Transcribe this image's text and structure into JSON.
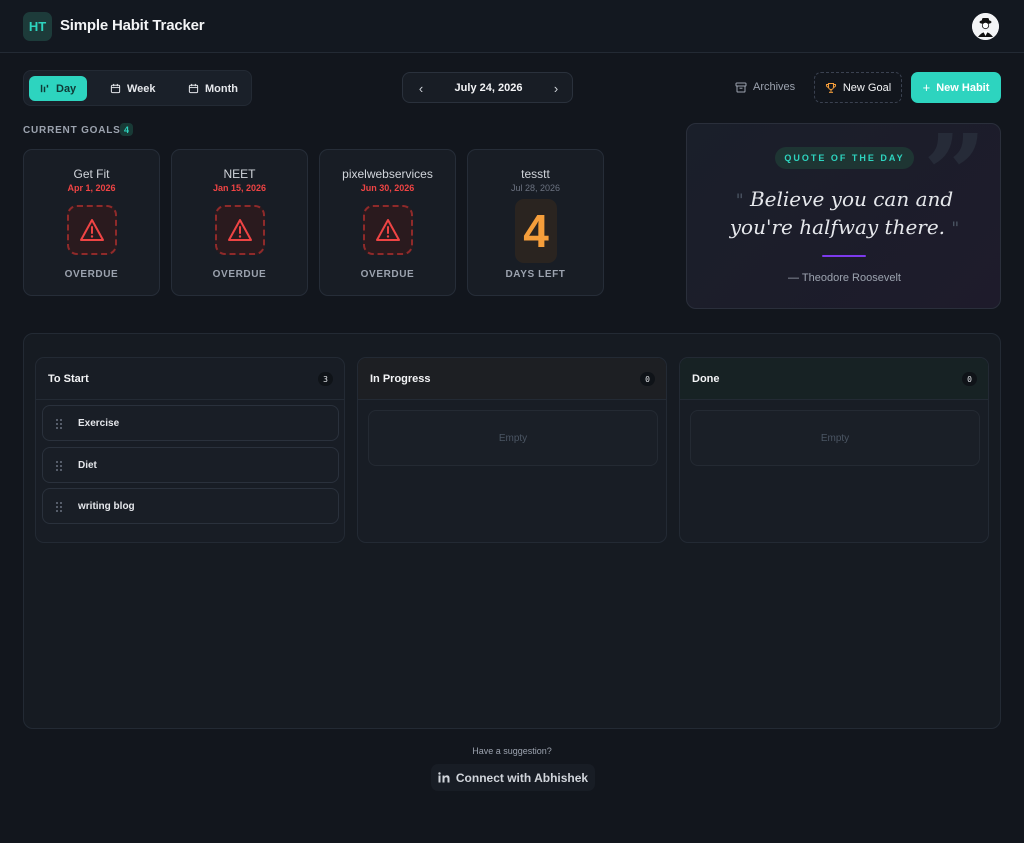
{
  "header": {
    "logo_text": "HT",
    "title": "Simple Habit Tracker"
  },
  "toolbar": {
    "views": [
      {
        "label": "Day",
        "active": true
      },
      {
        "label": "Week",
        "active": false
      },
      {
        "label": "Month",
        "active": false
      }
    ],
    "date": "July 24, 2026",
    "archives_label": "Archives",
    "new_goal_label": "New Goal",
    "new_habit_label": "New Habit"
  },
  "goals": {
    "heading": "CURRENT GOALS",
    "count": "4",
    "items": [
      {
        "name": "Get Fit",
        "date": "Apr 1, 2026",
        "status": "OVERDUE"
      },
      {
        "name": "NEET",
        "date": "Jan 15, 2026",
        "status": "OVERDUE"
      },
      {
        "name": "pixelwebservices",
        "date": "Jun 30, 2026",
        "status": "OVERDUE"
      },
      {
        "name": "tesstt",
        "date": "Jul 28, 2026",
        "days": "4",
        "status": "DAYS LEFT"
      }
    ]
  },
  "quote": {
    "tag": "QUOTE OF THE DAY",
    "text": "Believe you can and you're halfway there.",
    "author": "— Theodore Roosevelt",
    "accent_color": "#7c3aed"
  },
  "board": {
    "columns": [
      {
        "title": "To Start",
        "count": "3",
        "tasks": [
          "Exercise",
          "Diet",
          "writing blog"
        ]
      },
      {
        "title": "In Progress",
        "count": "0",
        "empty_label": "Empty"
      },
      {
        "title": "Done",
        "count": "0",
        "empty_label": "Empty"
      }
    ]
  },
  "footer": {
    "suggestion": "Have a suggestion?",
    "connect_label": "Connect with Abhishek"
  },
  "colors": {
    "accent": "#2dd4bf",
    "danger": "#ef4444",
    "warning": "#f59e3b",
    "background": "#12161d"
  }
}
